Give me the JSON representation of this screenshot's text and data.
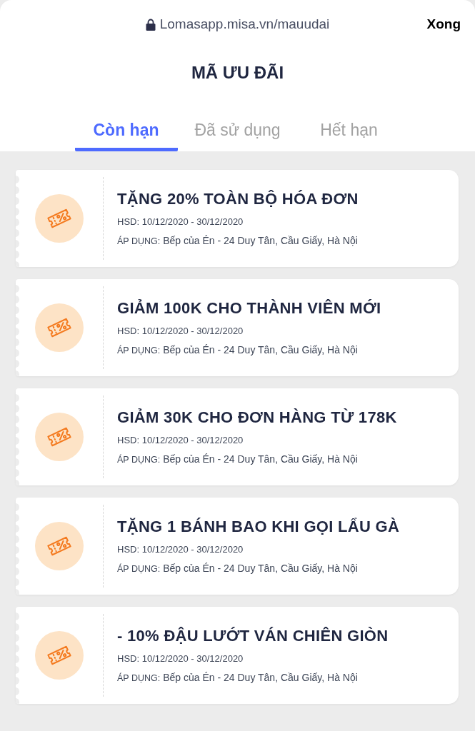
{
  "address_bar": {
    "url": "Lomasapp.misa.vn/mauudai",
    "done": "Xong"
  },
  "title": "MÃ ƯU ĐÃI",
  "tabs": [
    {
      "label": "Còn hạn",
      "selected": true
    },
    {
      "label": "Đã sử dụng",
      "selected": false
    },
    {
      "label": "Hết hạn",
      "selected": false
    }
  ],
  "vouchers": [
    {
      "title": "TẶNG 20% TOÀN BỘ HÓA ĐƠN",
      "validity": "HSD: 10/12/2020 - 30/12/2020",
      "applies_label": "ÁP DỤNG:",
      "applies": "Bếp của Én - 24 Duy Tân, Cầu Giấy, Hà Nội"
    },
    {
      "title": "GIẢM 100K CHO THÀNH VIÊN MỚI",
      "validity": "HSD: 10/12/2020 - 30/12/2020",
      "applies_label": "ÁP DỤNG:",
      "applies": "Bếp của Én - 24 Duy Tân, Cầu Giấy, Hà Nội"
    },
    {
      "title": "GIẢM 30K CHO ĐƠN HÀNG TỪ 178K",
      "validity": "HSD: 10/12/2020 - 30/12/2020",
      "applies_label": "ÁP DỤNG:",
      "applies": "Bếp của Én - 24 Duy Tân, Cầu Giấy, Hà Nội"
    },
    {
      "title": "TẶNG 1 BÁNH BAO KHI GỌI LẨU GÀ",
      "validity": "HSD: 10/12/2020 - 30/12/2020",
      "applies_label": "ÁP DỤNG:",
      "applies": "Bếp của Én - 24 Duy Tân, Cầu Giấy, Hà Nội"
    },
    {
      "title": "- 10% ĐẬU LƯỚT VÁN CHIÊN GIÒN",
      "validity": "HSD: 10/12/2020 - 30/12/2020",
      "applies_label": "ÁP DỤNG:",
      "applies": "Bếp của Én - 24 Duy Tân, Cầu Giấy, Hà Nội"
    }
  ]
}
